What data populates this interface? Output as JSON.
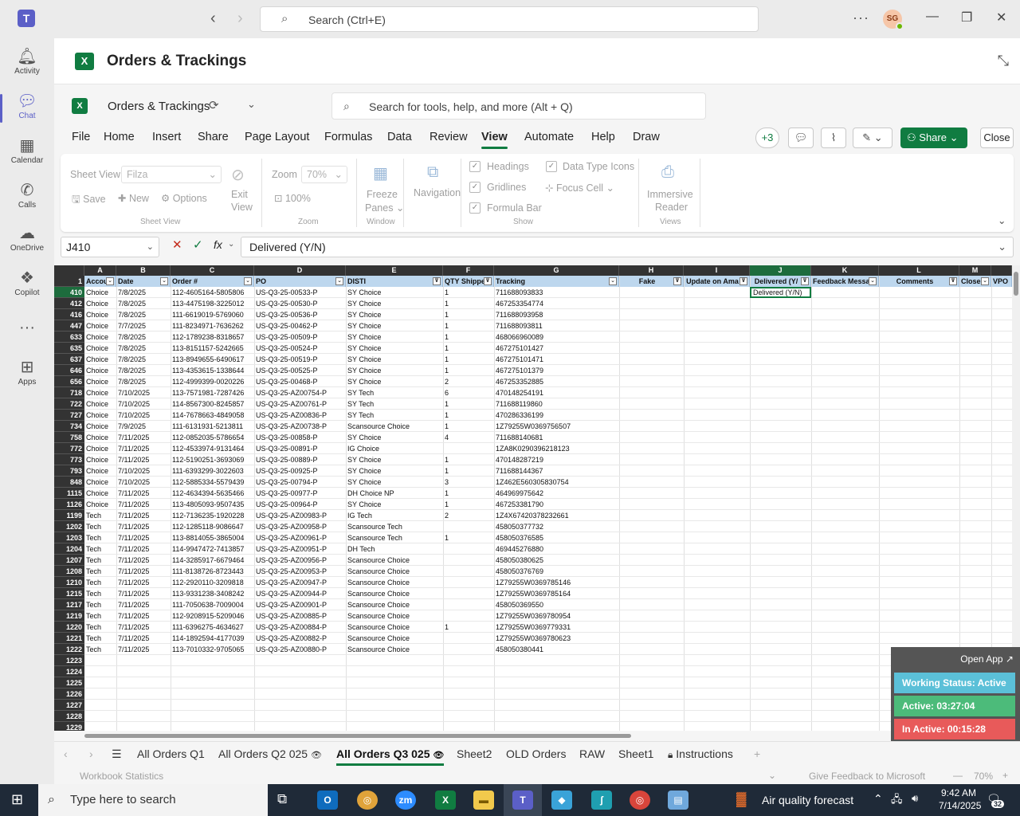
{
  "teams": {
    "search_placeholder": "Search (Ctrl+E)",
    "avatar_initials": "SG",
    "rail": [
      {
        "label": "Activity",
        "icon": "bell-icon"
      },
      {
        "label": "Chat",
        "icon": "chat-icon"
      },
      {
        "label": "Calendar",
        "icon": "calendar-icon"
      },
      {
        "label": "Calls",
        "icon": "phone-icon"
      },
      {
        "label": "OneDrive",
        "icon": "cloud-icon"
      },
      {
        "label": "Copilot",
        "icon": "copilot-icon"
      },
      {
        "label": "Apps",
        "icon": "apps-icon"
      }
    ]
  },
  "app": {
    "title": "Orders & Trackings"
  },
  "excel": {
    "workbook_name": "Orders & Trackings",
    "search_placeholder": "Search for tools, help, and more (Alt + Q)",
    "menu": [
      "File",
      "Home",
      "Insert",
      "Share",
      "Page Layout",
      "Formulas",
      "Data",
      "Review",
      "View",
      "Automate",
      "Help",
      "Draw"
    ],
    "active_menu": "View",
    "collab_count": "+3",
    "share_label": "Share",
    "close_label": "Close",
    "ribbon": {
      "sheet_view_label": "Sheet View",
      "sheet_view_value": "Filza",
      "save": "Save",
      "new": "New",
      "options": "Options",
      "exit_view": [
        "Exit",
        "View"
      ],
      "group_sheet_view": "Sheet View",
      "zoom_label": "Zoom",
      "zoom_value": "70%",
      "zoom_100": "100%",
      "group_zoom": "Zoom",
      "freeze": [
        "Freeze",
        "Panes"
      ],
      "group_window": "Window",
      "navigation": "Navigation",
      "headings": "Headings",
      "gridlines": "Gridlines",
      "formula_bar": "Formula Bar",
      "data_type_icons": "Data Type Icons",
      "focus_cell": "Focus Cell",
      "group_show": "Show",
      "immersive": [
        "Immersive",
        "Reader"
      ],
      "group_views": "Views"
    },
    "name_box": "J410",
    "formula": "Delivered (Y/N)"
  },
  "sheet": {
    "columns": [
      {
        "letter": "A",
        "header": "Accou"
      },
      {
        "letter": "B",
        "header": "Date"
      },
      {
        "letter": "C",
        "header": "Order #"
      },
      {
        "letter": "D",
        "header": "PO"
      },
      {
        "letter": "E",
        "header": "DISTI"
      },
      {
        "letter": "F",
        "header": "QTY Shippe"
      },
      {
        "letter": "G",
        "header": "Tracking"
      },
      {
        "letter": "H",
        "header": "Fake"
      },
      {
        "letter": "I",
        "header": "Update on Ama"
      },
      {
        "letter": "J",
        "header": "Delivered (Y/"
      },
      {
        "letter": "K",
        "header": "Feedback Messa"
      },
      {
        "letter": "L",
        "header": "Comments"
      },
      {
        "letter": "M",
        "header": "Close"
      },
      {
        "letter": "",
        "header": "VPO"
      }
    ],
    "selected_cell_text": "Delivered (Y/N)",
    "rows": [
      [
        "410",
        "Choice",
        "7/8/2025",
        "112-4605164-5805806",
        "US-Q3-25-00533-P",
        "SY Choice",
        "1",
        "711688093833"
      ],
      [
        "412",
        "Choice",
        "7/8/2025",
        "113-4475198-3225012",
        "US-Q3-25-00530-P",
        "SY Choice",
        "1",
        "467253354774"
      ],
      [
        "416",
        "Choice",
        "7/8/2025",
        "111-6619019-5769060",
        "US-Q3-25-00536-P",
        "SY Choice",
        "1",
        "711688093958"
      ],
      [
        "447",
        "Choice",
        "7/7/2025",
        "111-8234971-7636262",
        "US-Q3-25-00462-P",
        "SY Choice",
        "1",
        "711688093811"
      ],
      [
        "633",
        "Choice",
        "7/8/2025",
        "112-1789238-8318657",
        "US-Q3-25-00509-P",
        "SY Choice",
        "1",
        "468066960089"
      ],
      [
        "635",
        "Choice",
        "7/8/2025",
        "113-8151157-5242665",
        "US-Q3-25-00524-P",
        "SY Choice",
        "1",
        "467275101427"
      ],
      [
        "637",
        "Choice",
        "7/8/2025",
        "113-8949655-6490617",
        "US-Q3-25-00519-P",
        "SY Choice",
        "1",
        "467275101471"
      ],
      [
        "646",
        "Choice",
        "7/8/2025",
        "113-4353615-1338644",
        "US-Q3-25-00525-P",
        "SY Choice",
        "1",
        "467275101379"
      ],
      [
        "656",
        "Choice",
        "7/8/2025",
        "112-4999399-0020226",
        "US-Q3-25-00468-P",
        "SY Choice",
        "2",
        "467253352885"
      ],
      [
        "718",
        "Choice",
        "7/10/2025",
        "113-7571981-7287426",
        "US-Q3-25-AZ00754-P",
        "SY Tech",
        "6",
        "470148254191"
      ],
      [
        "722",
        "Choice",
        "7/10/2025",
        "114-8567300-8245857",
        "US-Q3-25-AZ00761-P",
        "SY Tech",
        "1",
        "711688119860"
      ],
      [
        "727",
        "Choice",
        "7/10/2025",
        "114-7678663-4849058",
        "US-Q3-25-AZ00836-P",
        "SY Tech",
        "1",
        "470286336199"
      ],
      [
        "734",
        "Choice",
        "7/9/2025",
        "111-6131931-5213811",
        "US-Q3-25-AZ00738-P",
        "Scansource Choice",
        "1",
        "1Z79255W0369756507"
      ],
      [
        "758",
        "Choice",
        "7/11/2025",
        "112-0852035-5786654",
        "US-Q3-25-00858-P",
        "SY Choice",
        "4",
        "711688140681"
      ],
      [
        "772",
        "Choice",
        "7/11/2025",
        "112-4533974-9131464",
        "US-Q3-25-00891-P",
        "IG Choice",
        "",
        "1ZA8K0290396218123"
      ],
      [
        "773",
        "Choice",
        "7/11/2025",
        "112-5190251-3693069",
        "US-Q3-25-00889-P",
        "SY Choice",
        "1",
        "470148287219"
      ],
      [
        "793",
        "Choice",
        "7/10/2025",
        "111-6393299-3022603",
        "US-Q3-25-00925-P",
        "SY Choice",
        "1",
        "711688144367"
      ],
      [
        "848",
        "Choice",
        "7/10/2025",
        "112-5885334-5579439",
        "US-Q3-25-00794-P",
        "SY Choice",
        "3",
        "1Z462E560305830754"
      ],
      [
        "1115",
        "Choice",
        "7/11/2025",
        "112-4634394-5635466",
        "US-Q3-25-00977-P",
        "DH Choice NP",
        "1",
        "464969975642"
      ],
      [
        "1126",
        "Choice",
        "7/11/2025",
        "113-4805093-9507435",
        "US-Q3-25-00964-P",
        "SY Choice",
        "1",
        "467253381790"
      ],
      [
        "1199",
        "Tech",
        "7/11/2025",
        "112-7136235-1920228",
        "US-Q3-25-AZ00983-P",
        "IG Tech",
        "2",
        "1Z4X67420378232661"
      ],
      [
        "1202",
        "Tech",
        "7/11/2025",
        "112-1285118-9086647",
        "US-Q3-25-AZ00958-P",
        "Scansource Tech",
        "",
        "458050377732"
      ],
      [
        "1203",
        "Tech",
        "7/11/2025",
        "113-8814055-3865004",
        "US-Q3-25-AZ00961-P",
        "Scansource Tech",
        "1",
        "458050376585"
      ],
      [
        "1204",
        "Tech",
        "7/11/2025",
        "114-9947472-7413857",
        "US-Q3-25-AZ00951-P",
        "DH Tech",
        "",
        "469445276880"
      ],
      [
        "1207",
        "Tech",
        "7/11/2025",
        "114-3285917-6679464",
        "US-Q3-25-AZ00956-P",
        "Scansource Choice",
        "",
        "458050380625"
      ],
      [
        "1208",
        "Tech",
        "7/11/2025",
        "111-8138726-8723443",
        "US-Q3-25-AZ00953-P",
        "Scansource Choice",
        "",
        "458050376769"
      ],
      [
        "1210",
        "Tech",
        "7/11/2025",
        "112-2920110-3209818",
        "US-Q3-25-AZ00947-P",
        "Scansource Choice",
        "",
        "1Z79255W0369785146"
      ],
      [
        "1215",
        "Tech",
        "7/11/2025",
        "113-9331238-3408242",
        "US-Q3-25-AZ00944-P",
        "Scansource Choice",
        "",
        "1Z79255W0369785164"
      ],
      [
        "1217",
        "Tech",
        "7/11/2025",
        "111-7050638-7009004",
        "US-Q3-25-AZ00901-P",
        "Scansource Choice",
        "",
        "458050369550"
      ],
      [
        "1219",
        "Tech",
        "7/11/2025",
        "112-9208915-5209046",
        "US-Q3-25-AZ00885-P",
        "Scansource Choice",
        "",
        "1Z79255W0369780954"
      ],
      [
        "1220",
        "Tech",
        "7/11/2025",
        "111-6396275-4634627",
        "US-Q3-25-AZ00884-P",
        "Scansource Choice",
        "1",
        "1Z79255W0369779331"
      ],
      [
        "1221",
        "Tech",
        "7/11/2025",
        "114-1892594-4177039",
        "US-Q3-25-AZ00882-P",
        "Scansource Choice",
        "",
        "1Z79255W0369780623"
      ],
      [
        "1222",
        "Tech",
        "7/11/2025",
        "113-7010332-9705065",
        "US-Q3-25-AZ00880-P",
        "Scansource Choice",
        "",
        "458050380441"
      ]
    ],
    "empty_rows": [
      "1223",
      "1224",
      "1225",
      "1226",
      "1227",
      "1228",
      "1229"
    ]
  },
  "sheet_tabs": [
    "All Orders Q1",
    "All Orders Q2 025",
    "All Orders Q3 025",
    "Sheet2",
    "OLD Orders",
    "RAW",
    "Sheet1",
    "Instructions"
  ],
  "active_sheet": "All Orders Q3 025",
  "status": {
    "left": "Workbook Statistics",
    "feedback": "Give Feedback to Microsoft",
    "zoom": "70%"
  },
  "widget": {
    "open_app": "Open App ↗",
    "working": "Working Status: Active",
    "active": "Active: 03:27:04",
    "inactive": "In Active: 00:15:28",
    "colors": {
      "working": "#5bc0d8",
      "active": "#4cbb7a",
      "inactive": "#e85a5a"
    }
  },
  "taskbar": {
    "search_placeholder": "Type here to search",
    "weather": "Air quality forecast",
    "time": "9:42 AM",
    "date": "7/14/2025",
    "notifications": "32"
  }
}
